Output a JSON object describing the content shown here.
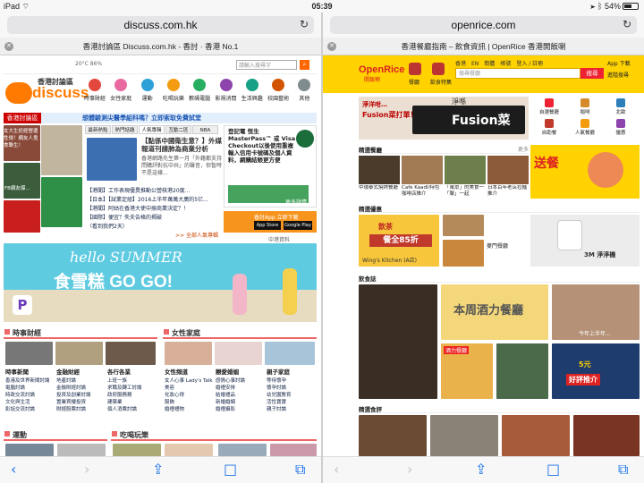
{
  "status": {
    "device": "iPad",
    "time": "05:39",
    "battery": "54%"
  },
  "left": {
    "url": "discuss.com.hk",
    "tab_title": "香港討論區 Discuss.com.hk - 香討 · 香港 No.1",
    "logo_top": "香港討論區",
    "logo": "discuss",
    "weather": "20°C 86%",
    "top_search_placeholder": "請輸入搜尋字",
    "nav": [
      "時事財經",
      "女性家庭",
      "運動",
      "吃喝玩樂",
      "數碼電腦",
      "影視消閒",
      "生活興趣",
      "校園藝術",
      "其他"
    ],
    "hot_label": "香港討論區",
    "promo_banner": "想體驗測尖醫學組科嗎？立即索取免費試堂",
    "tabs": [
      "最新熱點",
      "熱門話題",
      "人氣專輯",
      "互動二區",
      "NBA"
    ],
    "side_thumb_text": "女大生拒經營遭性侵！網友人鬼食難生！",
    "side_thumb_text2": "FB網友爆...",
    "article_title": "【點係中國衛生意？】外媒報道刊請肺為商業分析",
    "article_body": "香港網路先生第一月「外籍都支持問購評對抗中共」的聲音，但暫時不是這樣...",
    "list": [
      "【港聞】工作表現優異推動公營核港20度...",
      "【日本】【試業定組】2016上半年萬萬大廣的5亿...",
      "【港聞】阿姑在香港大使中換商業決定？！",
      "【國際】便宜？失夫告格的揭破",
      "（看到我們2天）"
    ],
    "list_more": "&gt;&gt; 全部人氣專輯",
    "ad_title": "登記電 恆生MasterPass™ 或 Visa Checkout以後使用重複輸入信用卡號碼及個人資料，網購結賬更方便",
    "ad_btn": "更多詳情",
    "app_label": "香討App 立即下載",
    "appstore": "App Store",
    "googleplay": "Google Play",
    "promo_script": "hello SUMMER",
    "promo_main": "食雪糕 GO GO!",
    "sec1_title": "時事財經",
    "sec2_title": "女性家庭",
    "sec1_cols": [
      {
        "h": "時事新聞",
        "items": [
          "香港及世界新聞討論",
          "電腦討論",
          "時政交流討論",
          "文化與生活",
          "影話交流討論"
        ]
      },
      {
        "h": "金融財經",
        "items": [
          "地產討論",
          "金融財經討論",
          "投資及創業討論",
          "置業買樓投資",
          "財經股票討論"
        ]
      },
      {
        "h": "各行各業",
        "items": [
          "上班一族",
          "求職及轉工討論",
          "政府服務務",
          "建築業",
          "個人消費討論"
        ]
      }
    ],
    "sec2_cols": [
      {
        "h": "女性頻道",
        "items": [
          "女人心事 Lady's Talk",
          "美容",
          "化妝心得",
          "服飾",
          "婚禮禮物"
        ]
      },
      {
        "h": "戀愛婚姻",
        "items": [
          "感情心事討論",
          "婚禮安排",
          "結婚禮品",
          "新婚婚姻",
          "婚禮攝影"
        ]
      },
      {
        "h": "親子家庭",
        "items": [
          "等待懷孕",
          "懷孕討論",
          "幼兒園教育",
          "活性寶寶",
          "親子討論"
        ]
      }
    ],
    "sec3_title": "運動",
    "sec4_title": "吃喝玩樂",
    "mini_label": "中港資料"
  },
  "right": {
    "url": "openrice.com",
    "tab_title": "香港餐廳指南 – 飲食資訊 | OpenRice 香港開飯喇",
    "logo": "OpenRice",
    "logo_sub": "開飯喇",
    "nav": [
      "餐廳",
      "飲食特集"
    ],
    "top_links": [
      "香港",
      "EN",
      "簡體",
      "帳號",
      "登入 / 註冊"
    ],
    "search_placeholder": "搜尋餐廳",
    "search_btn": "搜尋",
    "adv_search": "進階搜尋",
    "app_dl": "App 下載",
    "hero_text1": "淨洋咁…",
    "hero_text2": "淨喺",
    "hero_text3": "Fusion菜打單！",
    "hero_big": "Fusion菜",
    "icons": [
      "自選餐廳",
      "咖啡",
      "北歐",
      "自助餐",
      "人氣餐廳",
      "優惠"
    ],
    "promo_side": "送餐",
    "sec_list": "精選餐廳",
    "sec_more": "更多",
    "cards": [
      {
        "t": "中環泰式燒烤餐廳"
      },
      {
        "t": "Cafe Kaadl/特色咖啡店推介"
      },
      {
        "t": "「萬眾」的美食一「聚」一起"
      },
      {
        "t": "日本百年老店拉麵推介"
      }
    ],
    "deal_label": "精選優惠",
    "coupon": "飲茶",
    "coupon_pct": "餐全85折",
    "deal1": "Wing's Kitchen (A店)",
    "deal2": "麥門餐廳",
    "deal3": "3M 淨淨機",
    "sec_food": "飲食誌",
    "food_item1": "本周酒力餐廳",
    "food_item2": "好評推介",
    "food_tag": "今年上半年...",
    "sec_bottom": "精選食評",
    "footer_chip": "5元",
    "food_badge": "酒力餐廳"
  },
  "toolbar": {
    "back": "‹",
    "forward": "›",
    "share": "⇪",
    "bookmarks": "□",
    "tabs": "⧉"
  }
}
